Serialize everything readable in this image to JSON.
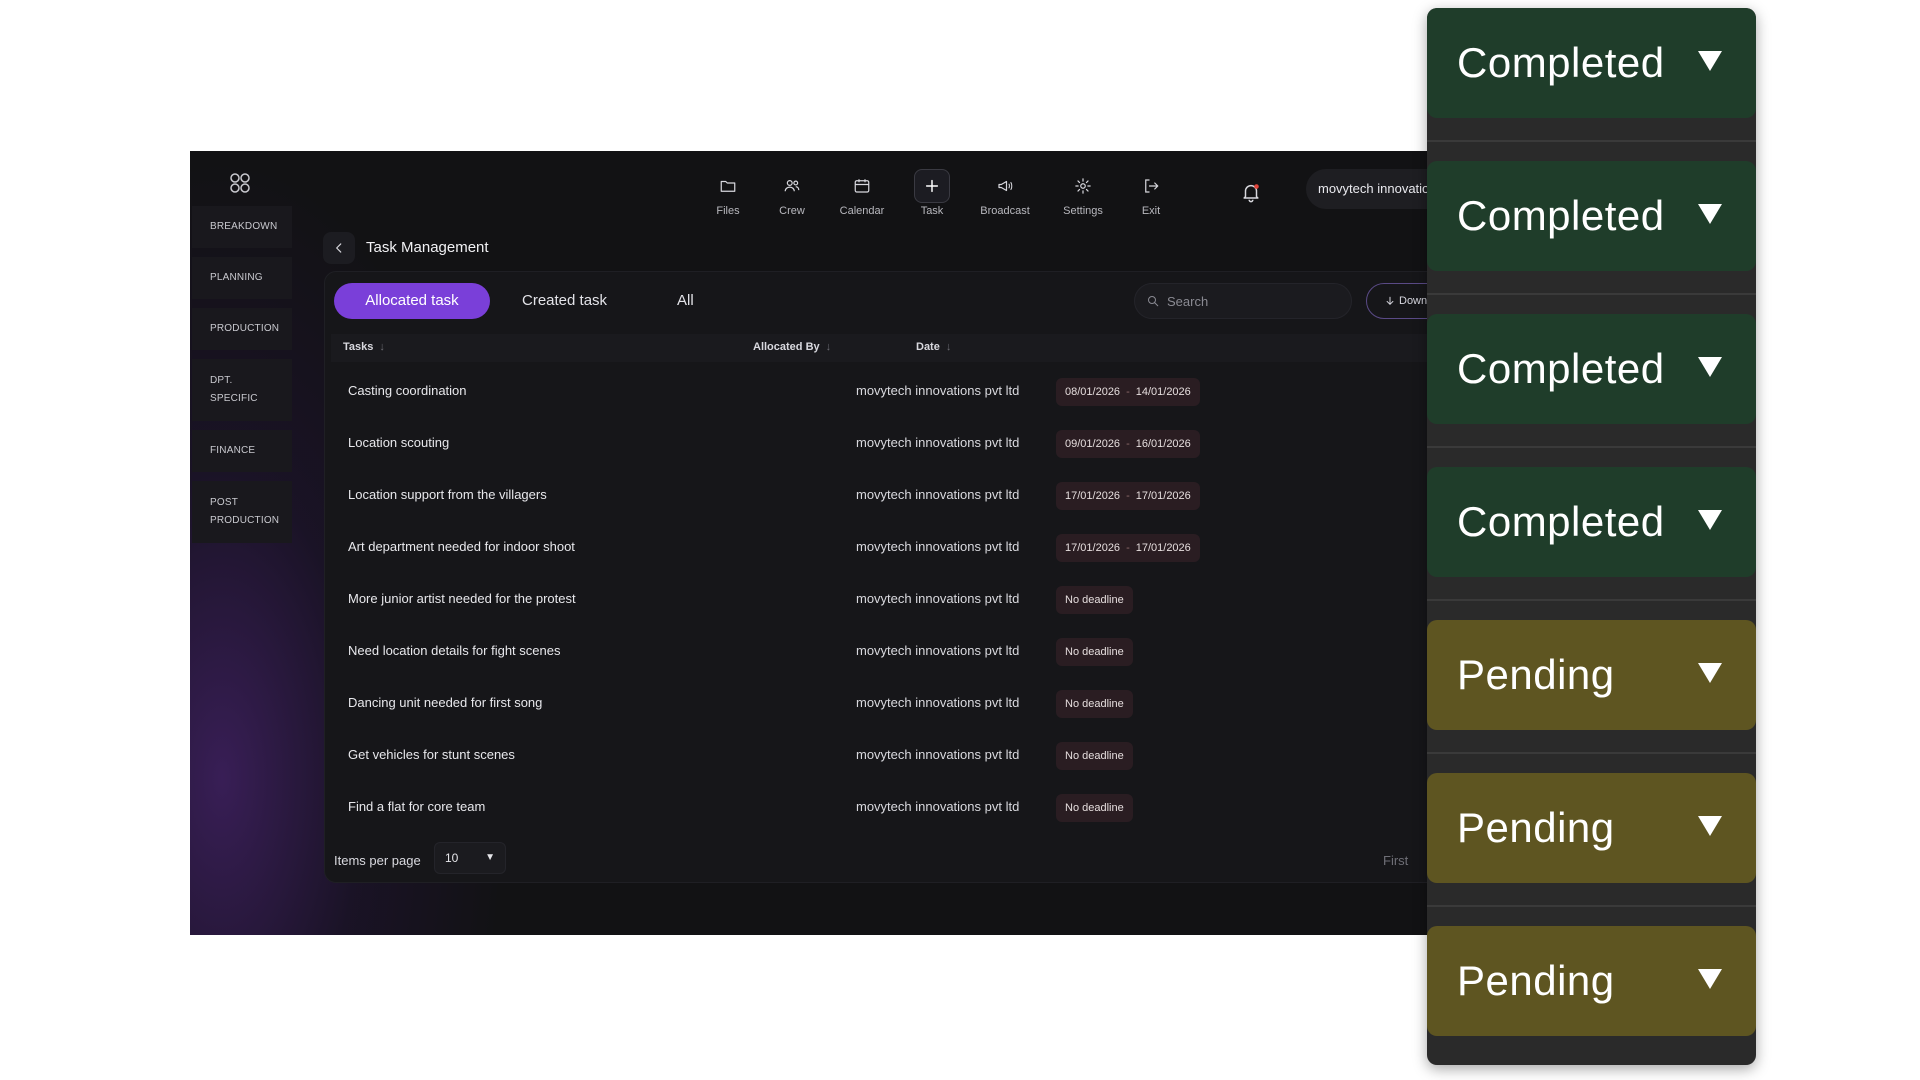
{
  "sidebar": {
    "items": [
      {
        "label": "BREAKDOWN"
      },
      {
        "label": "PLANNING"
      },
      {
        "label": "PRODUCTION"
      },
      {
        "label": "DPT.\nSPECIFIC"
      },
      {
        "label": "FINANCE"
      },
      {
        "label": "POST\nPRODUCTION"
      }
    ]
  },
  "nav": {
    "items": [
      {
        "label": "Files",
        "icon": "folder-icon"
      },
      {
        "label": "Crew",
        "icon": "crew-icon"
      },
      {
        "label": "Calendar",
        "icon": "calendar-icon"
      },
      {
        "label": "Task",
        "icon": "plus-icon"
      },
      {
        "label": "Broadcast",
        "icon": "megaphone-icon"
      },
      {
        "label": "Settings",
        "icon": "gear-icon"
      },
      {
        "label": "Exit",
        "icon": "exit-icon"
      }
    ],
    "active": "Task",
    "profile": "movytech innovations pvt ltd"
  },
  "page": {
    "title": "Task Management"
  },
  "tabs": [
    {
      "label": "Allocated task",
      "active": true
    },
    {
      "label": "Created task",
      "active": false
    },
    {
      "label": "All",
      "active": false
    }
  ],
  "search": {
    "placeholder": "Search"
  },
  "download": {
    "label": "Down"
  },
  "table": {
    "headers": {
      "tasks": "Tasks",
      "allocated_by": "Allocated By",
      "date": "Date"
    },
    "rows": [
      {
        "task": "Casting coordination",
        "by": "movytech innovations pvt ltd",
        "start": "08/01/2026",
        "end": "14/01/2026"
      },
      {
        "task": "Location scouting",
        "by": "movytech innovations pvt ltd",
        "start": "09/01/2026",
        "end": "16/01/2026"
      },
      {
        "task": "Location support from the villagers",
        "by": "movytech innovations pvt ltd",
        "start": "17/01/2026",
        "end": "17/01/2026"
      },
      {
        "task": "Art department needed for indoor shoot",
        "by": "movytech innovations pvt ltd",
        "start": "17/01/2026",
        "end": "17/01/2026"
      },
      {
        "task": "More junior artist needed for the protest",
        "by": "movytech innovations pvt ltd",
        "deadline": "No deadline"
      },
      {
        "task": "Need location details for fight scenes",
        "by": "movytech innovations pvt ltd",
        "deadline": "No deadline"
      },
      {
        "task": "Dancing unit needed for first song",
        "by": "movytech innovations pvt ltd",
        "deadline": "No deadline"
      },
      {
        "task": "Get vehicles for stunt scenes",
        "by": "movytech innovations pvt ltd",
        "deadline": "No deadline"
      },
      {
        "task": "Find a flat for core team",
        "by": "movytech innovations pvt ltd",
        "deadline": "No deadline"
      }
    ]
  },
  "pagination": {
    "items_per_page_label": "Items per page",
    "items_per_page_value": "10",
    "first_label": "First"
  },
  "status_dropdowns": [
    {
      "label": "Completed",
      "state": "completed"
    },
    {
      "label": "Completed",
      "state": "completed"
    },
    {
      "label": "Completed",
      "state": "completed"
    },
    {
      "label": "Completed",
      "state": "completed"
    },
    {
      "label": "Pending",
      "state": "pending"
    },
    {
      "label": "Pending",
      "state": "pending"
    },
    {
      "label": "Pending",
      "state": "pending"
    }
  ],
  "colors": {
    "accent": "#7a3fd9",
    "completed": "#1f3d2a",
    "pending": "#5e5521",
    "background": "#121214"
  }
}
